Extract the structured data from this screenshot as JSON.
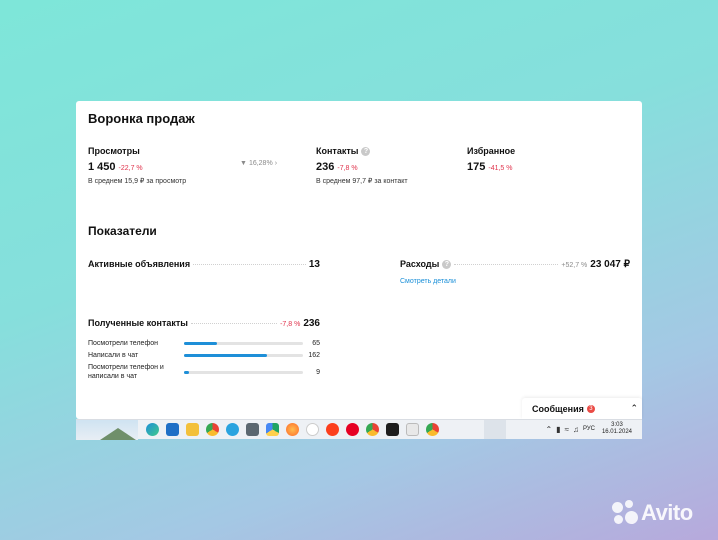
{
  "funnel": {
    "title": "Воронка продаж",
    "views": {
      "label": "Просмотры",
      "value": "1 450",
      "change": "-22,7 %",
      "sub": "В среднем 15,9 ₽ за просмотр"
    },
    "conversion": "16,28%",
    "contacts": {
      "label": "Контакты",
      "value": "236",
      "change": "-7,8 %",
      "sub": "В среднем 97,7 ₽ за контакт"
    },
    "favorites": {
      "label": "Избранное",
      "value": "175",
      "change": "-41,5 %"
    }
  },
  "metrics": {
    "title": "Показатели",
    "active_ads": {
      "label": "Активные объявления",
      "value": "13"
    },
    "expenses": {
      "label": "Расходы",
      "change": "+52,7 %",
      "value": "23 047 ₽",
      "link": "Смотреть детали"
    },
    "received_contacts": {
      "label": "Полученные контакты",
      "change": "-7,8 %",
      "value": "236",
      "rows": [
        {
          "label": "Посмотрели телефон",
          "value": "65",
          "fraction": 0.28
        },
        {
          "label": "Написали в чат",
          "value": "162",
          "fraction": 0.7
        },
        {
          "label": "Посмотрели телефон и написали в чат",
          "value": "9",
          "fraction": 0.04
        }
      ]
    }
  },
  "messages": {
    "title": "Сообщения",
    "badge": "3"
  },
  "taskbar": {
    "lang": "РУС",
    "time": "3:03",
    "date": "16.01.2024",
    "icons": [
      "edge-icon",
      "mail-icon",
      "files-icon",
      "chrome-icon",
      "telegram-icon",
      "calculator-icon",
      "google-drive-icon",
      "firefox-icon",
      "yandex-browser-icon",
      "yandex-icon",
      "pinterest-icon",
      "chrome-icon",
      "figma-icon",
      "photos-icon",
      "chrome-icon"
    ]
  },
  "watermark": "Avito",
  "colors": {
    "accent": "#1e8fd8",
    "negative": "#e0324b",
    "badge": "#ea4b45"
  }
}
